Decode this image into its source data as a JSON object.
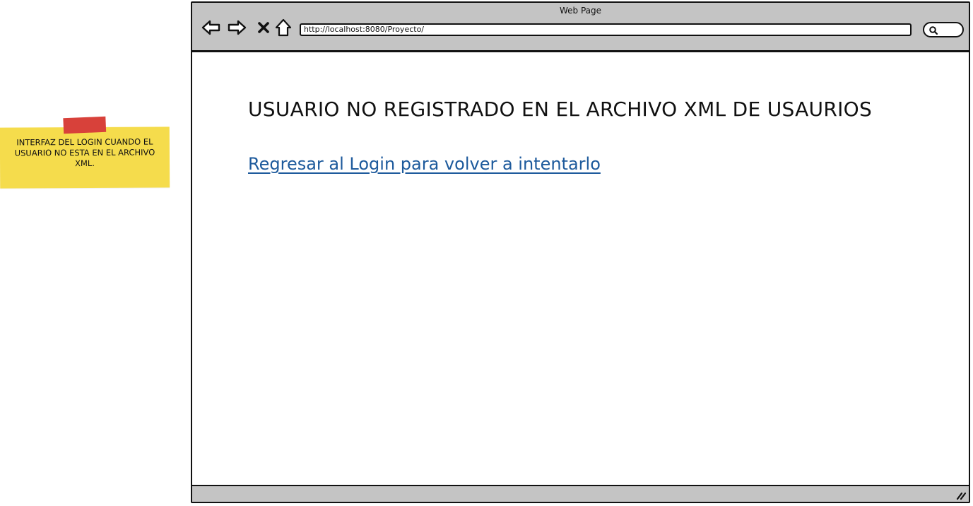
{
  "note": {
    "text": "INTERFAZ DEL LOGIN CUANDO EL USUARIO NO ESTA EN EL ARCHIVO XML.",
    "tape_color": "#d8413a",
    "bg_color": "#f5dc4c"
  },
  "browser": {
    "title": "Web Page",
    "address": "http://localhost:8080/Proyecto/",
    "icons": {
      "back": "arrow-left-icon",
      "forward": "arrow-right-icon",
      "stop": "close-icon",
      "home": "home-icon",
      "search": "search-icon",
      "resize": "resize-grip-icon"
    }
  },
  "page": {
    "heading": "USUARIO NO REGISTRADO EN EL ARCHIVO XML DE USAURIOS",
    "link_text": "Regresar al Login para volver a intentarlo",
    "link_color": "#1d5a9c"
  }
}
